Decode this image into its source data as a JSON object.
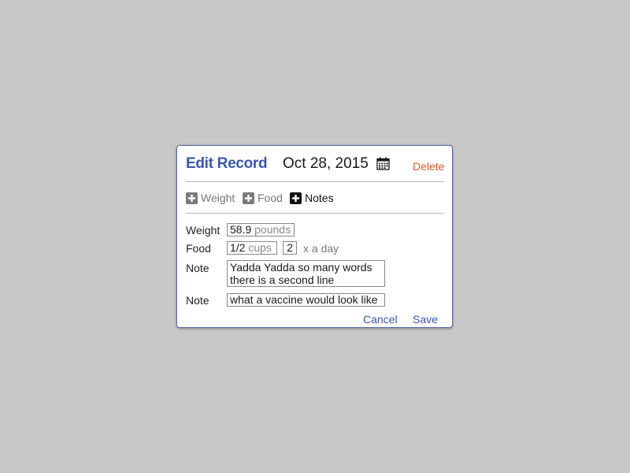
{
  "dialog": {
    "title": "Edit Record",
    "date": "Oct 28, 2015",
    "delete_label": "Delete"
  },
  "toggles": {
    "weight": "Weight",
    "food": "Food",
    "notes": "Notes"
  },
  "weight_row": {
    "label": "Weight",
    "value": "58.9",
    "unit": "pounds"
  },
  "food_row": {
    "label": "Food",
    "amount": "1/2",
    "unit": "cups",
    "times": "2",
    "frequency": "x a day"
  },
  "notes": [
    {
      "label": "Note",
      "line1": "Yadda Yadda so many words",
      "line2": "there is a second line"
    },
    {
      "label": "Note",
      "line1": "what a vaccine would look like"
    }
  ],
  "actions": {
    "cancel": "Cancel",
    "save": "Save"
  },
  "icons": {
    "calendar": "calendar-icon",
    "toggle_add": "plus-square-icon"
  },
  "colors": {
    "background": "#c8c8c8",
    "title": "#3a55b4",
    "delete": "#e8572a",
    "link": "#3a55b4",
    "toggle_inactive": "#7a7a7a",
    "toggle_active": "#111111"
  }
}
